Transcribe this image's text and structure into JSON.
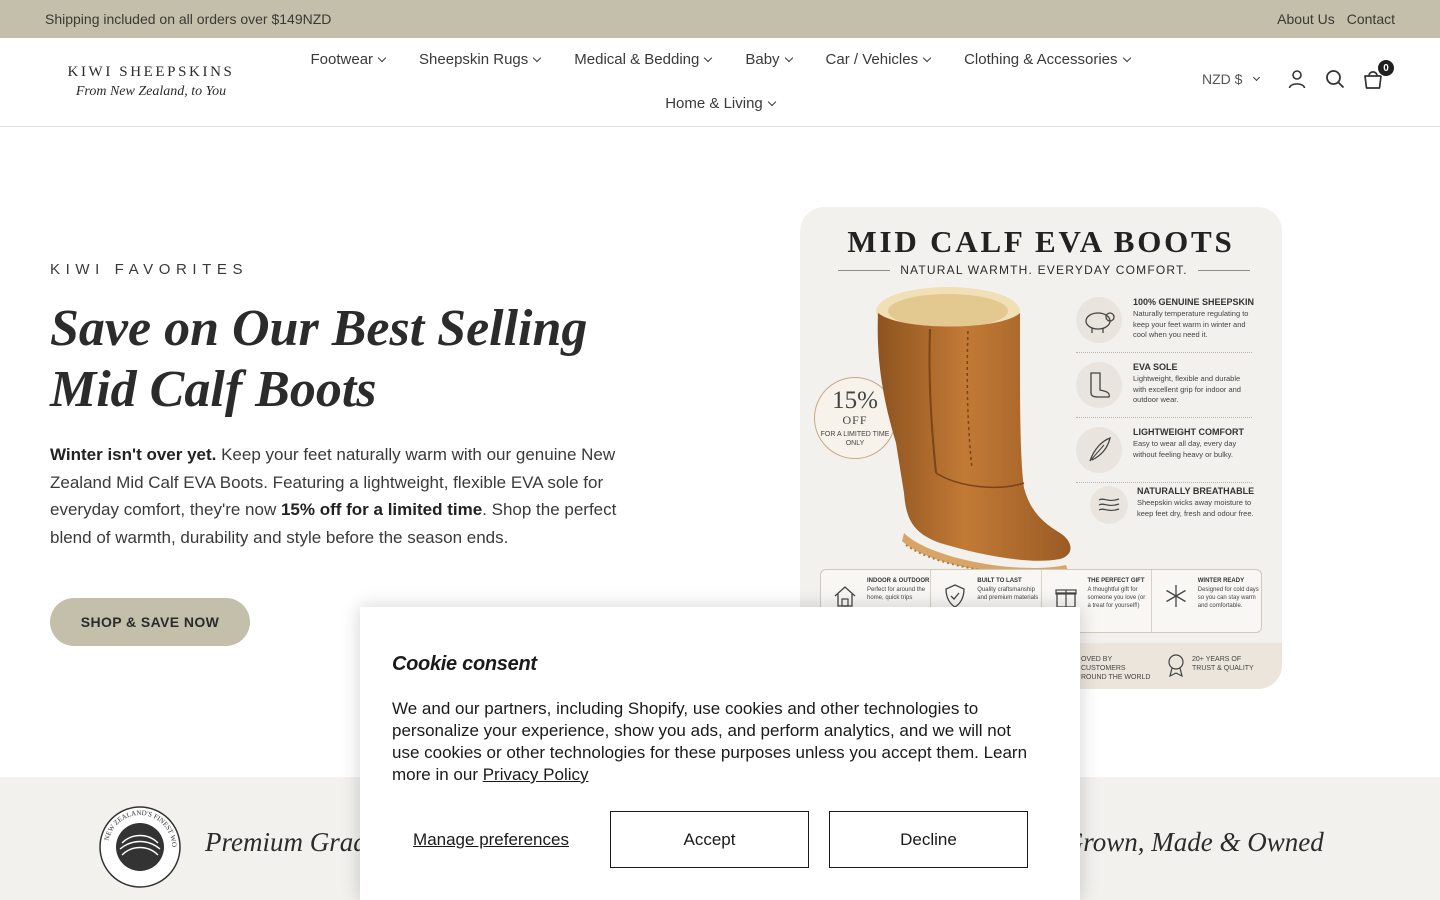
{
  "announcement": {
    "text": "Shipping included on all orders over $149NZD",
    "links": [
      "About Us",
      "Contact"
    ]
  },
  "header": {
    "logo_line1": "KIWI SHEEPSKINS",
    "logo_line2": "From New Zealand, to You",
    "nav": [
      "Footwear",
      "Sheepskin Rugs",
      "Medical & Bedding",
      "Baby",
      "Car / Vehicles",
      "Clothing & Accessories",
      "Home & Living"
    ],
    "currency": "NZD $",
    "cart_count": "0",
    "icons": [
      "account-icon",
      "search-icon",
      "cart-icon"
    ]
  },
  "hero": {
    "eyebrow": "KIWI FAVORITES",
    "title": "Save on Our Best Selling Mid Calf Boots",
    "body_bold1": "Winter isn't over yet.",
    "body_text1": " Keep your feet naturally warm with our genuine New Zealand Mid Calf EVA Boots. Featuring a lightweight, flexible EVA sole for everyday comfort, they're now ",
    "body_bold2": "15% off for a limited time",
    "body_text2": ". Shop the perfect blend of warmth, durability and style before the season ends.",
    "cta": "SHOP & SAVE NOW"
  },
  "promo_image": {
    "title": "MID CALF EVA BOOTS",
    "subtitle": "NATURAL WARMTH. EVERYDAY COMFORT.",
    "discount_pct": "15%",
    "discount_off": "OFF",
    "discount_note": "FOR A LIMITED TIME ONLY",
    "features": [
      {
        "title": "100% GENUINE SHEEPSKIN",
        "desc": "Naturally temperature regulating to keep your feet warm in winter and cool when you need it."
      },
      {
        "title": "EVA SOLE",
        "desc": "Lightweight, flexible and durable with excellent grip for indoor and outdoor wear."
      },
      {
        "title": "LIGHTWEIGHT COMFORT",
        "desc": "Easy to wear all day, every day without feeling heavy or bulky."
      },
      {
        "title": "NATURALLY BREATHABLE",
        "desc": "Sheepskin wicks away moisture to keep feet dry, fresh and odour free."
      }
    ],
    "strip": [
      {
        "title": "INDOOR & OUTDOOR",
        "desc": "Perfect for around the home, quick trips"
      },
      {
        "title": "BUILT TO LAST",
        "desc": "Quality craftsmanship and premium materials"
      },
      {
        "title": "THE PERFECT GIFT",
        "desc": "A thoughtful gift for someone you love (or a treat for yourself!)"
      },
      {
        "title": "WINTER READY",
        "desc": "Designed for cold days so you can stay warm and comfortable."
      }
    ],
    "bottom_left": "OVED BY CUSTOMERS ROUND THE WORLD",
    "bottom_right": "20+ YEARS OF TRUST & QUALITY"
  },
  "trust_band": {
    "left_text": "Premium Grad",
    "right_text": "Z Grown, Made & Owned",
    "seal_text": "NEW ZEALAND'S FINEST WOOL PRODUCTS"
  },
  "cookie": {
    "title": "Cookie consent",
    "body": "We and our partners, including Shopify, use cookies and other technologies to personalize your experience, show you ads, and perform analytics, and we will not use cookies or other technologies for these purposes unless you accept them. Learn more in our ",
    "link": "Privacy Policy",
    "manage": "Manage preferences",
    "accept": "Accept",
    "decline": "Decline"
  },
  "colors": {
    "accent": "#c4bfab",
    "band_bg": "#f2f1ee",
    "boot": "#b8722e"
  }
}
